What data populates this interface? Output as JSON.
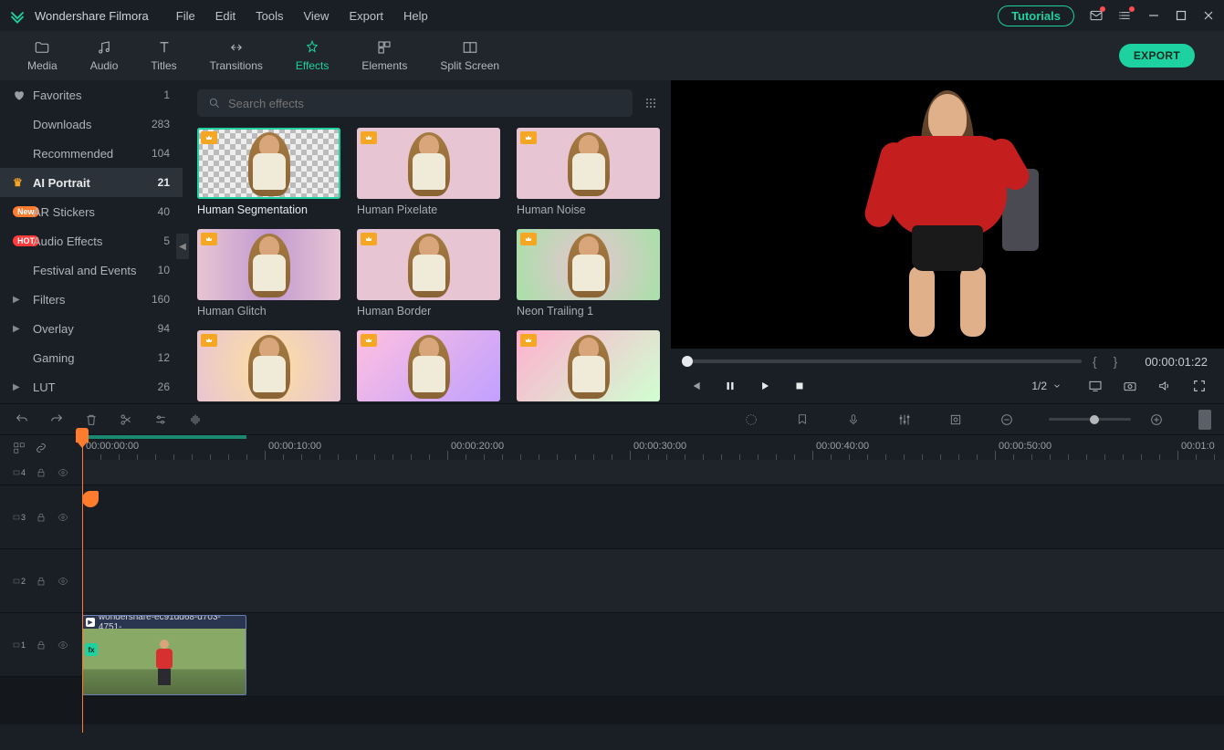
{
  "app": {
    "title": "Wondershare Filmora"
  },
  "menu": [
    "File",
    "Edit",
    "Tools",
    "View",
    "Export",
    "Help"
  ],
  "titleRight": {
    "tutorials": "Tutorials"
  },
  "tabs": [
    {
      "id": "media",
      "label": "Media"
    },
    {
      "id": "audio",
      "label": "Audio"
    },
    {
      "id": "titles",
      "label": "Titles"
    },
    {
      "id": "transitions",
      "label": "Transitions"
    },
    {
      "id": "effects",
      "label": "Effects",
      "active": true
    },
    {
      "id": "elements",
      "label": "Elements"
    },
    {
      "id": "split",
      "label": "Split Screen"
    }
  ],
  "export_label": "EXPORT",
  "sidebar": [
    {
      "icon": "heart",
      "label": "Favorites",
      "count": 1
    },
    {
      "label": "Downloads",
      "count": 283
    },
    {
      "label": "Recommended",
      "count": 104
    },
    {
      "icon": "crown",
      "label": "AI Portrait",
      "count": 21,
      "active": true
    },
    {
      "badge": "New",
      "label": "AR Stickers",
      "count": 40
    },
    {
      "badge": "HOT",
      "label": "Audio Effects",
      "count": 5
    },
    {
      "label": "Festival and Events",
      "count": 10
    },
    {
      "icon": "chev",
      "label": "Filters",
      "count": 160
    },
    {
      "icon": "chev",
      "label": "Overlay",
      "count": 94
    },
    {
      "label": "Gaming",
      "count": 12
    },
    {
      "icon": "chev",
      "label": "LUT",
      "count": 26
    }
  ],
  "search": {
    "placeholder": "Search effects"
  },
  "effects": [
    {
      "label": "Human Segmentation",
      "selected": true,
      "variant": "checker"
    },
    {
      "label": "Human Pixelate",
      "variant": "pink"
    },
    {
      "label": "Human Noise",
      "variant": "pink"
    },
    {
      "label": "Human Glitch",
      "variant": "glitch"
    },
    {
      "label": "Human Border",
      "variant": "border"
    },
    {
      "label": "Neon Trailing 1",
      "variant": "neon"
    },
    {
      "label": "",
      "variant": "glow1"
    },
    {
      "label": "",
      "variant": "glow2"
    },
    {
      "label": "",
      "variant": "glow3"
    }
  ],
  "preview": {
    "timecode": "00:00:01:22",
    "ratio": "1/2"
  },
  "ruler": {
    "labels": [
      "00:00:00:00",
      "00:00:10:00",
      "00:00:20:00",
      "00:00:30:00",
      "00:00:40:00",
      "00:00:50:00",
      "00:01:0"
    ]
  },
  "tracks": [
    {
      "id": "4",
      "narrow": true
    },
    {
      "id": "3"
    },
    {
      "id": "2"
    },
    {
      "id": "1",
      "clip": {
        "name": "wondershare-ec91dd68-d703-4751-"
      }
    }
  ]
}
